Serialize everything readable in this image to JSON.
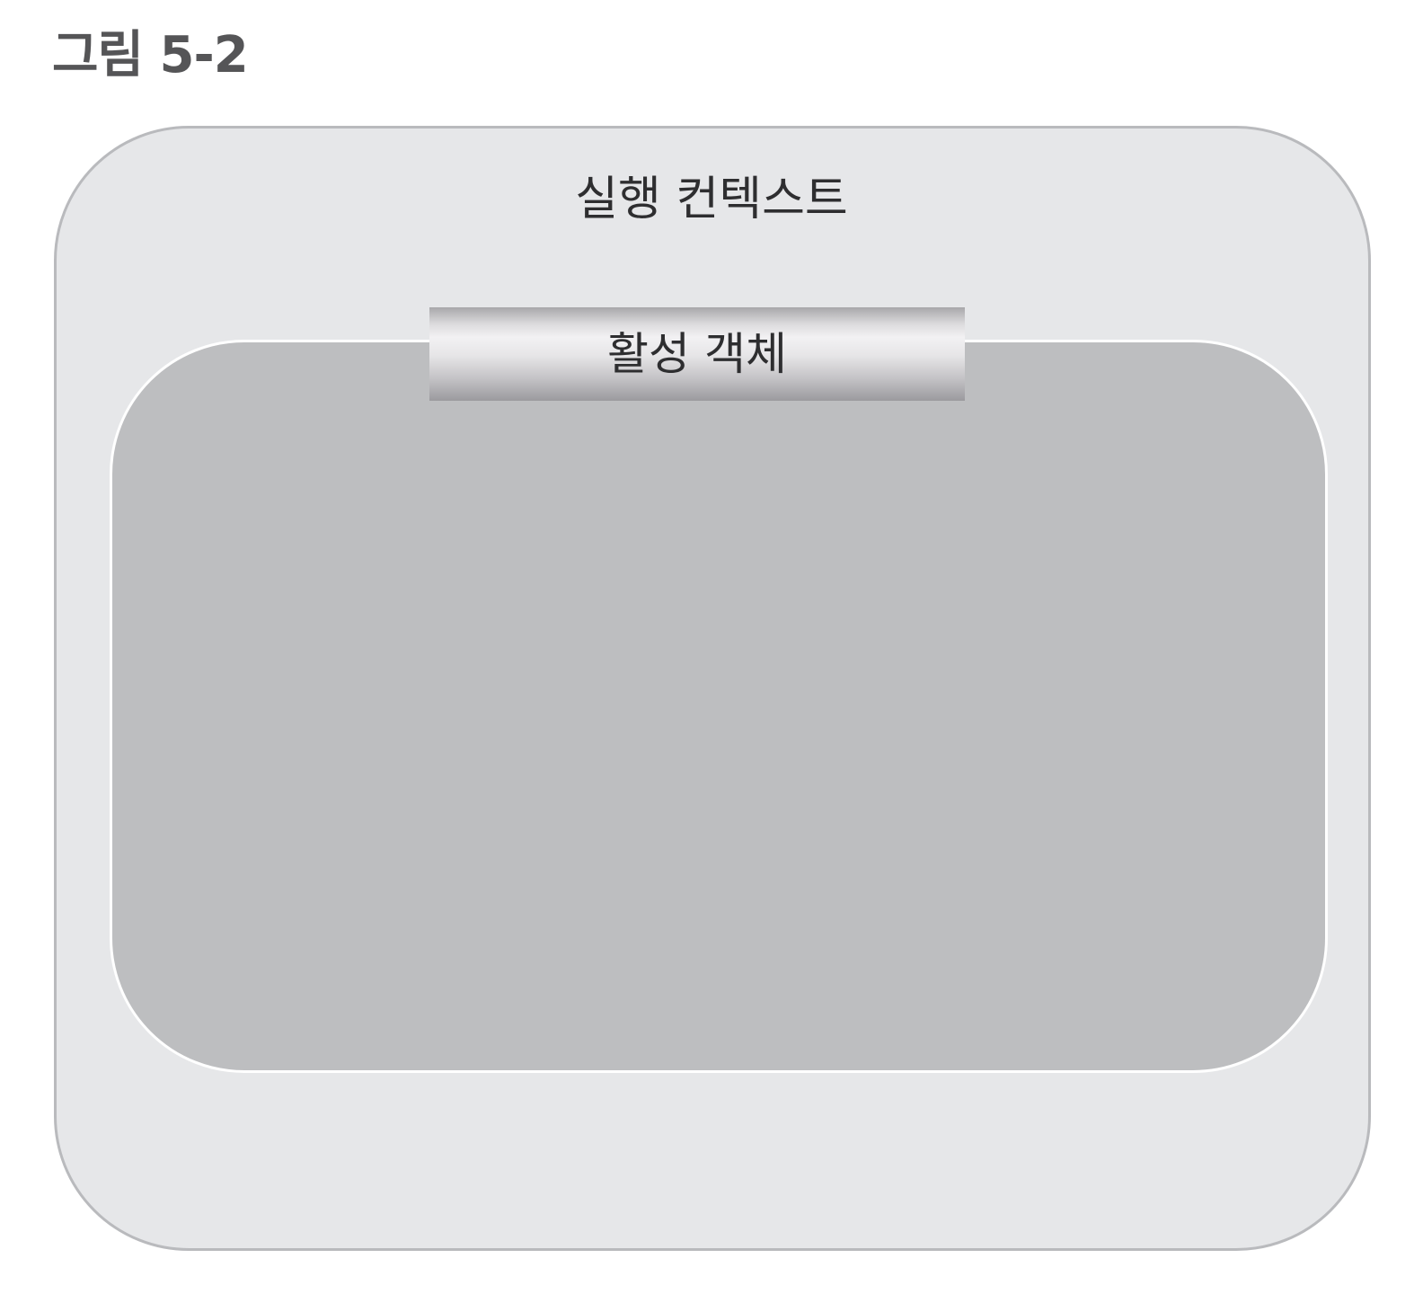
{
  "figure": {
    "label": "그림 5-2"
  },
  "execution_context": {
    "title": "실행 컨텍스트"
  },
  "activation_object": {
    "title": "활성 객체"
  },
  "colors": {
    "outer_fill": "#e6e7e9",
    "outer_border": "#b9babd",
    "inner_fill": "#bdbec0",
    "inner_border": "#ffffff",
    "text": "#2e2e30",
    "label_text": "#555557"
  }
}
